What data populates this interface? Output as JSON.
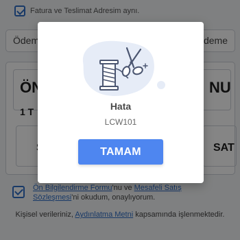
{
  "background": {
    "address_checkbox_label": "Fatura ve Teslimat Adresim aynı.",
    "payment_left": "Ödem",
    "payment_right": "deme",
    "summary_title_left": "ÖN",
    "summary_title_right": "NU",
    "summary_sub": "1 T",
    "summary_button_left": "S",
    "summary_button_right": "SAT",
    "agreement": {
      "link1": "Ön Bilgilendirme Formu",
      "text1": "'nu ve ",
      "link2": "Mesafeli Satış Sözleşmesi",
      "text2": "'ni okudum, onaylıyorum."
    },
    "kvkk": {
      "text1": "Kişisel verileriniz, ",
      "link": "Aydınlatma Metni",
      "text2": " kapsamında işlenmektedir."
    }
  },
  "modal": {
    "illustration_icon": "scissors-thread-spool-icon",
    "title": "Hata",
    "code": "LCW101",
    "button_label": "TAMAM",
    "colors": {
      "button": "#4e86f0",
      "illustration_blob": "#e6ecf7",
      "illustration_line": "#4a5570"
    }
  }
}
